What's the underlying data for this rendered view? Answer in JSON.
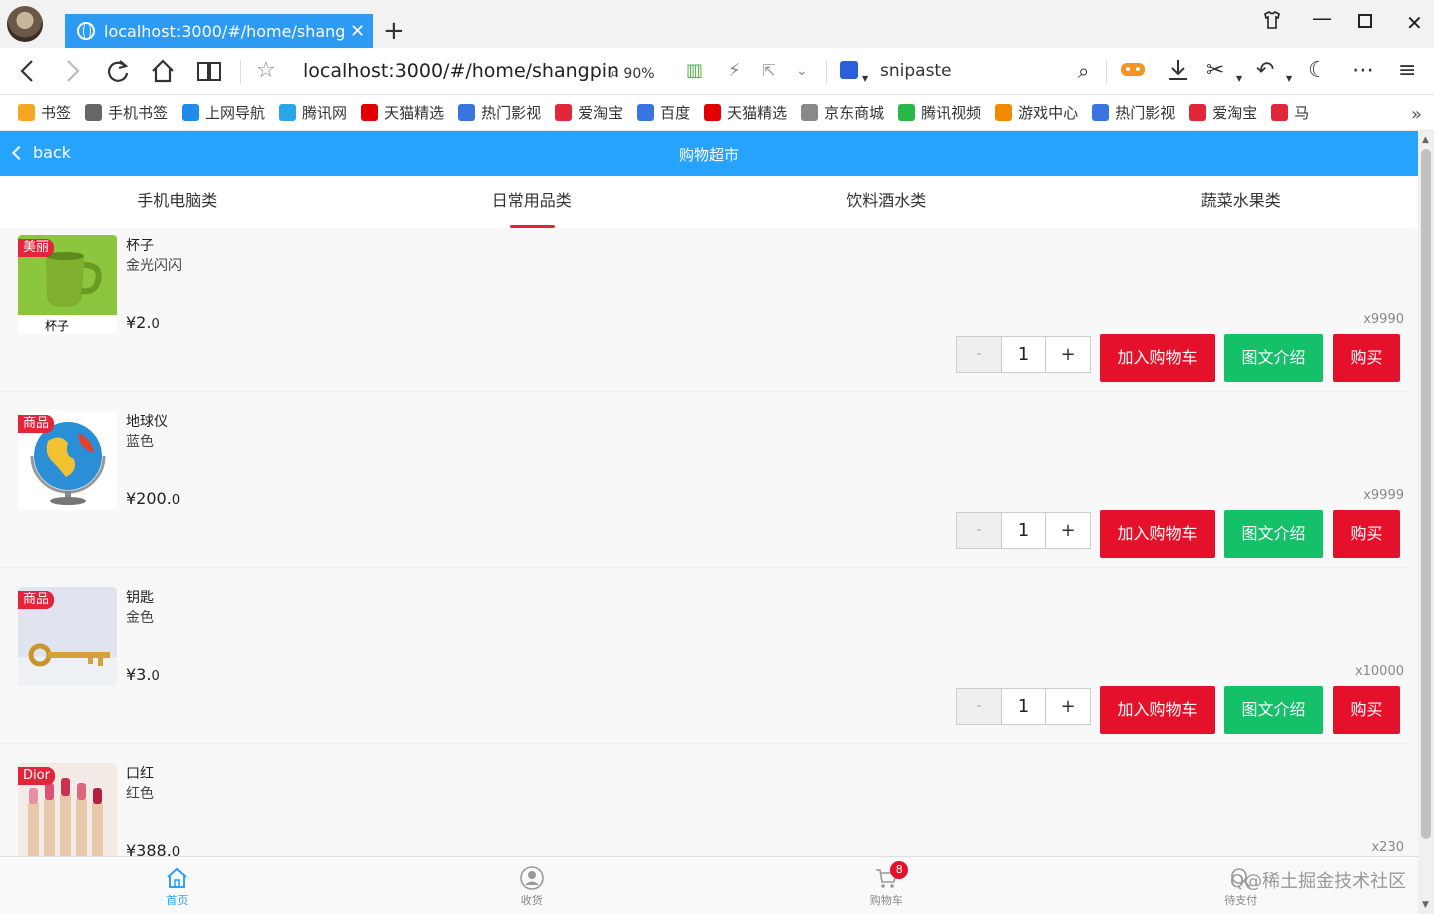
{
  "browser": {
    "tab_title": "localhost:3000/#/home/shangpin",
    "tab_close": "✕",
    "new_tab": "+",
    "address_url": "localhost:3000/#/home/shangpin",
    "zoom": "90%",
    "search_engine_text": "snipaste",
    "bookmarks": [
      {
        "label": "书签",
        "color": "#f5a623"
      },
      {
        "label": "手机书签",
        "color": "#666666"
      },
      {
        "label": "上网导航",
        "color": "#1f8ceb"
      },
      {
        "label": "腾讯网",
        "color": "#2aa5e5"
      },
      {
        "label": "天猫精选",
        "color": "#e00000"
      },
      {
        "label": "热门影视",
        "color": "#3a74e0"
      },
      {
        "label": "爱淘宝",
        "color": "#e0283a"
      },
      {
        "label": "百度",
        "color": "#3a74e0"
      },
      {
        "label": "天猫精选",
        "color": "#e00000"
      },
      {
        "label": "京东商城",
        "color": "#888888"
      },
      {
        "label": "腾讯视频",
        "color": "#29b84a"
      },
      {
        "label": "游戏中心",
        "color": "#f08a00"
      },
      {
        "label": "热门影视",
        "color": "#3a74e0"
      },
      {
        "label": "爱淘宝",
        "color": "#e0283a"
      },
      {
        "label": "马",
        "color": "#e0283a"
      }
    ],
    "bookmarks_more": "»"
  },
  "app": {
    "back_label": "back",
    "title": "购物超市",
    "categories": [
      "手机电脑类",
      "日常用品类",
      "饮料酒水类",
      "蔬菜水果类"
    ],
    "active_category": 1,
    "accent": "#26a2ff",
    "products": [
      {
        "badge": "美丽",
        "name": "杯子",
        "spec": "金光闪闪",
        "price_int": "¥2.",
        "price_dec": "0",
        "stock": "x9990",
        "qty": "1",
        "image": "cup"
      },
      {
        "badge": "商品",
        "name": "地球仪",
        "spec": "蓝色",
        "price_int": "¥200.",
        "price_dec": "0",
        "stock": "x9999",
        "qty": "1",
        "image": "globe"
      },
      {
        "badge": "商品",
        "name": "钥匙",
        "spec": "金色",
        "price_int": "¥3.",
        "price_dec": "0",
        "stock": "x10000",
        "qty": "1",
        "image": "key"
      },
      {
        "badge": "Dior",
        "name": "口红",
        "spec": "红色",
        "price_int": "¥388.",
        "price_dec": "0",
        "stock": "x230",
        "qty": "1",
        "image": "lipstick"
      }
    ],
    "buttons": {
      "minus": "-",
      "plus": "+",
      "add_cart": "加入购物车",
      "intro": "图文介绍",
      "buy": "购买"
    },
    "cup_caption": "杯子",
    "bottom_tabs": [
      {
        "label": "首页",
        "icon": "home-icon",
        "active": true
      },
      {
        "label": "收货",
        "icon": "user-icon",
        "active": false
      },
      {
        "label": "购物车",
        "icon": "cart-icon",
        "active": false,
        "badge": "8"
      },
      {
        "label": "待支付",
        "icon": "pay-icon",
        "active": false
      }
    ],
    "watermark": "Q@稀土掘金技术社区"
  }
}
